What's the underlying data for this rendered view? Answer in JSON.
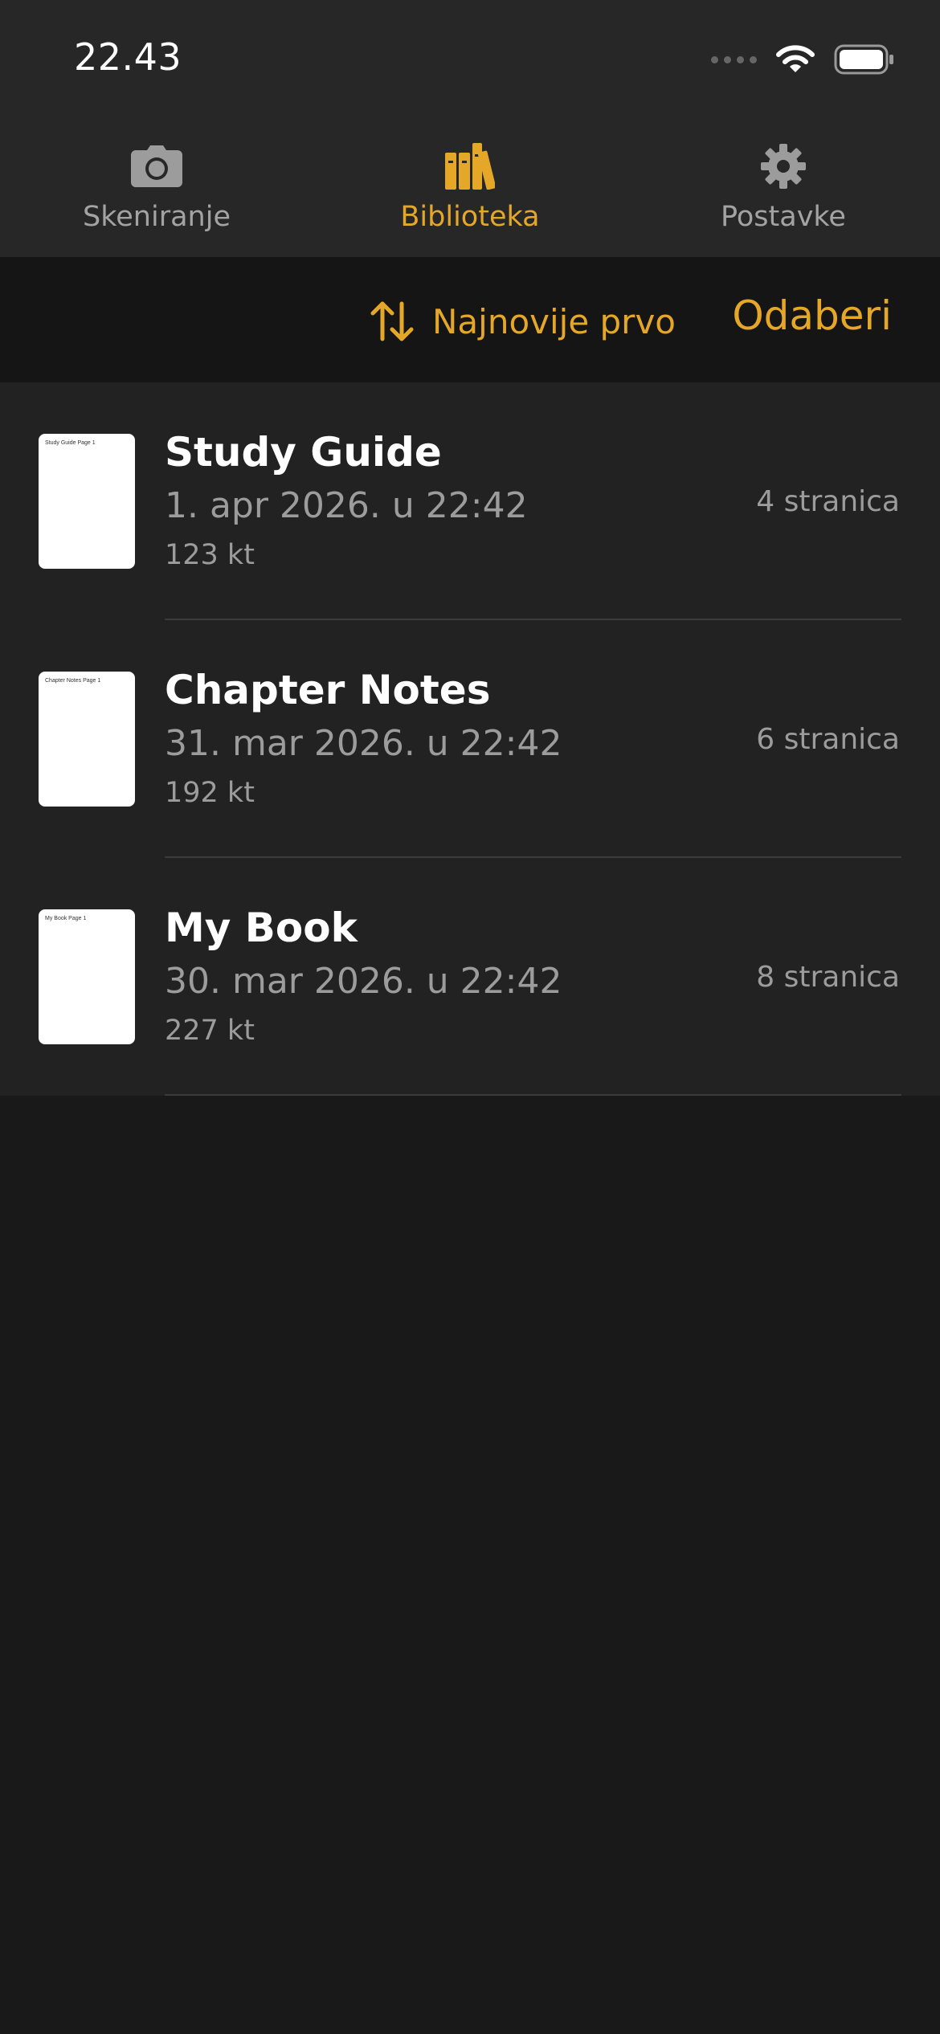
{
  "status_bar": {
    "time": "22.43"
  },
  "tabs": [
    {
      "label": "Skeniranje",
      "icon": "camera-icon",
      "active": false
    },
    {
      "label": "Biblioteka",
      "icon": "books-icon",
      "active": true
    },
    {
      "label": "Postavke",
      "icon": "gear-icon",
      "active": false
    }
  ],
  "toolbar": {
    "sort_label": "Najnovije prvo",
    "sort_icon": "sort-arrows-icon",
    "select_label": "Odaberi"
  },
  "documents": [
    {
      "title": "Study Guide",
      "date": "1. apr 2026. u 22:42",
      "size": "123 kt",
      "pages": "4 stranica",
      "thumb_text": "Study Guide Page 1"
    },
    {
      "title": "Chapter Notes",
      "date": "31. mar 2026. u 22:42",
      "size": "192 kt",
      "pages": "6 stranica",
      "thumb_text": "Chapter Notes Page 1"
    },
    {
      "title": "My Book",
      "date": "30. mar 2026. u 22:42",
      "size": "227 kt",
      "pages": "8 stranica",
      "thumb_text": "My Book Page 1"
    }
  ],
  "colors": {
    "accent": "#e5a728",
    "background": "#191919",
    "topbar": "#272727",
    "toolbar": "#151515",
    "list": "#222222",
    "secondary_text": "#9c9c9c"
  }
}
